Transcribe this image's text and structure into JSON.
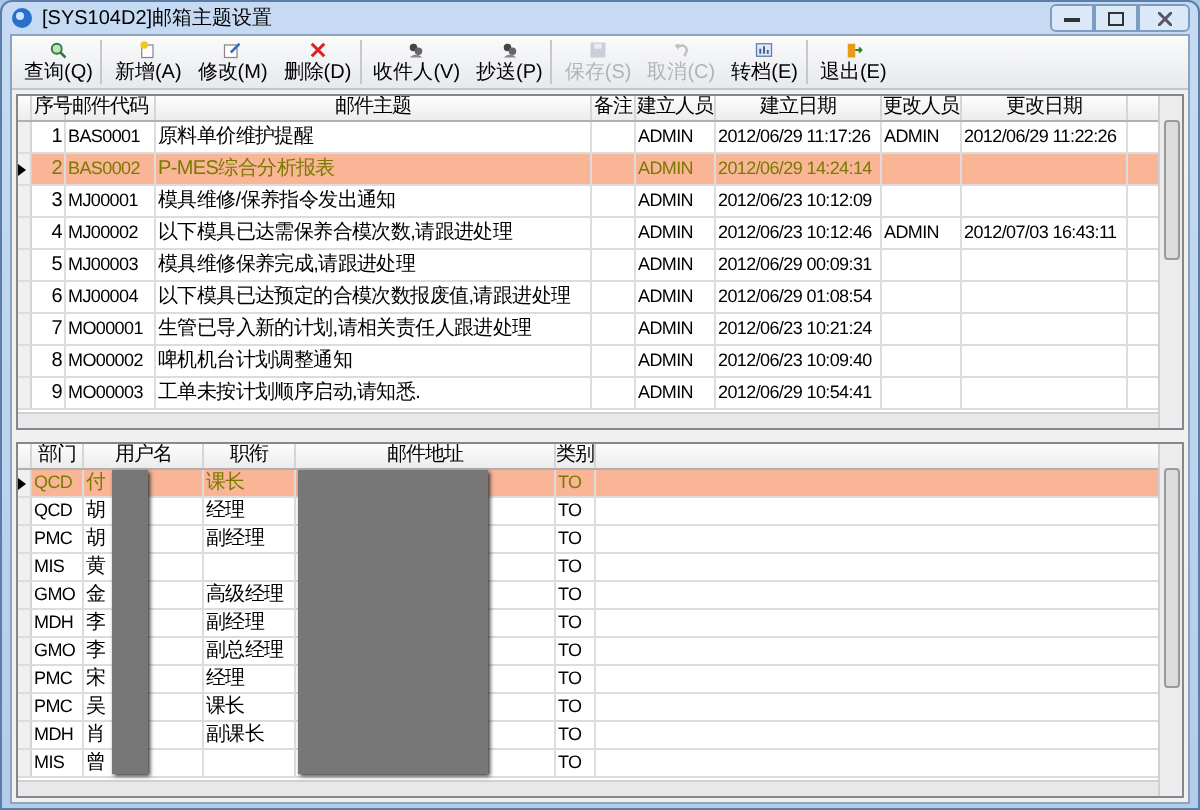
{
  "window": {
    "title": "[SYS104D2]邮箱主题设置"
  },
  "toolbar": [
    {
      "label": "查询(Q)",
      "kind": "search",
      "disabled": false,
      "separator_after": true
    },
    {
      "label": "新增(A)",
      "kind": "new",
      "disabled": false,
      "separator_after": false
    },
    {
      "label": "修改(M)",
      "kind": "edit",
      "disabled": false,
      "separator_after": false
    },
    {
      "label": "删除(D)",
      "kind": "delete",
      "disabled": false,
      "separator_after": true
    },
    {
      "label": "收件人(V)",
      "kind": "people",
      "disabled": false,
      "separator_after": false
    },
    {
      "label": "抄送(P)",
      "kind": "people",
      "disabled": false,
      "separator_after": true
    },
    {
      "label": "保存(S)",
      "kind": "save",
      "disabled": true,
      "separator_after": false
    },
    {
      "label": "取消(C)",
      "kind": "undo",
      "disabled": true,
      "separator_after": false
    },
    {
      "label": "转档(E)",
      "kind": "export",
      "disabled": false,
      "separator_after": true
    },
    {
      "label": "退出(E)",
      "kind": "exit",
      "disabled": false,
      "separator_after": false
    }
  ],
  "subjects": {
    "columns": [
      "序号",
      "邮件代码",
      "邮件主题",
      "备注",
      "建立人员",
      "建立日期",
      "更改人员",
      "更改日期"
    ],
    "rows": [
      {
        "cells": [
          "1",
          "BAS0001",
          "原料单价维护提醒",
          "",
          "ADMIN",
          "2012/06/29 11:17:26",
          "ADMIN",
          "2012/06/29 11:22:26"
        ],
        "selected": false
      },
      {
        "cells": [
          "2",
          "BAS0002",
          "P-MES综合分析报表",
          "",
          "ADMIN",
          "2012/06/29 14:24:14",
          "",
          ""
        ],
        "selected": true
      },
      {
        "cells": [
          "3",
          "MJ00001",
          "模具维修/保养指令发出通知",
          "",
          "ADMIN",
          "2012/06/23 10:12:09",
          "",
          ""
        ],
        "selected": false
      },
      {
        "cells": [
          "4",
          "MJ00002",
          "以下模具已达需保养合模次数,请跟进处理",
          "",
          "ADMIN",
          "2012/06/23 10:12:46",
          "ADMIN",
          "2012/07/03 16:43:11"
        ],
        "selected": false
      },
      {
        "cells": [
          "5",
          "MJ00003",
          "模具维修保养完成,请跟进处理",
          "",
          "ADMIN",
          "2012/06/29 00:09:31",
          "",
          ""
        ],
        "selected": false
      },
      {
        "cells": [
          "6",
          "MJ00004",
          "以下模具已达预定的合模次数报废值,请跟进处理",
          "",
          "ADMIN",
          "2012/06/29 01:08:54",
          "",
          ""
        ],
        "selected": false
      },
      {
        "cells": [
          "7",
          "MO00001",
          "生管已导入新的计划,请相关责任人跟进处理",
          "",
          "ADMIN",
          "2012/06/23 10:21:24",
          "",
          ""
        ],
        "selected": false
      },
      {
        "cells": [
          "8",
          "MO00002",
          "啤机机台计划调整通知",
          "",
          "ADMIN",
          "2012/06/23 10:09:40",
          "",
          ""
        ],
        "selected": false
      },
      {
        "cells": [
          "9",
          "MO00003",
          "工单未按计划顺序启动,请知悉.",
          "",
          "ADMIN",
          "2012/06/29 10:54:41",
          "",
          ""
        ],
        "selected": false
      }
    ]
  },
  "recipients": {
    "columns": [
      "部门",
      "用户名",
      "职衔",
      "邮件地址",
      "类别"
    ],
    "rows": [
      {
        "cells": [
          "QCD",
          "付",
          "课长",
          "",
          "TO"
        ],
        "selected": true
      },
      {
        "cells": [
          "QCD",
          "胡",
          "经理",
          "",
          "TO"
        ],
        "selected": false
      },
      {
        "cells": [
          "PMC",
          "胡",
          "副经理",
          "",
          "TO"
        ],
        "selected": false
      },
      {
        "cells": [
          "MIS",
          "黄",
          "",
          "",
          "TO"
        ],
        "selected": false
      },
      {
        "cells": [
          "GMO",
          "金",
          "高级经理",
          "",
          "TO"
        ],
        "selected": false
      },
      {
        "cells": [
          "MDH",
          "李",
          "副经理",
          "",
          "TO"
        ],
        "selected": false
      },
      {
        "cells": [
          "GMO",
          "李",
          "副总经理",
          "",
          "TO"
        ],
        "selected": false
      },
      {
        "cells": [
          "PMC",
          "宋",
          "经理",
          "",
          "TO"
        ],
        "selected": false
      },
      {
        "cells": [
          "PMC",
          "吴",
          "课长",
          "",
          "TO"
        ],
        "selected": false
      },
      {
        "cells": [
          "MDH",
          "肖",
          "副课长",
          "",
          "TO"
        ],
        "selected": false
      },
      {
        "cells": [
          "MIS",
          "曾",
          "",
          "",
          "TO"
        ],
        "selected": false
      }
    ]
  }
}
